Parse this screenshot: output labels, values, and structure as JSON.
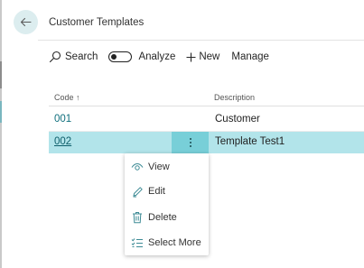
{
  "page": {
    "title": "Customer Templates"
  },
  "actions": {
    "search_label": "Search",
    "analyze_label": "Analyze",
    "new_label": "New",
    "manage_label": "Manage"
  },
  "table": {
    "columns": {
      "code": "Code ↑",
      "description": "Description"
    },
    "rows": [
      {
        "code": "001",
        "description": "Customer"
      },
      {
        "code": "002",
        "description": "Template Test1"
      }
    ]
  },
  "context_menu": {
    "items": [
      {
        "label": "View",
        "icon": "eye-icon"
      },
      {
        "label": "Edit",
        "icon": "pencil-icon"
      },
      {
        "label": "Delete",
        "icon": "trash-icon"
      },
      {
        "label": "Select More",
        "icon": "checklist-icon"
      }
    ]
  },
  "colors": {
    "accent": "#0f6f7d",
    "selected_row": "#b2e4ea",
    "row_menu_button": "#78cfd8"
  }
}
